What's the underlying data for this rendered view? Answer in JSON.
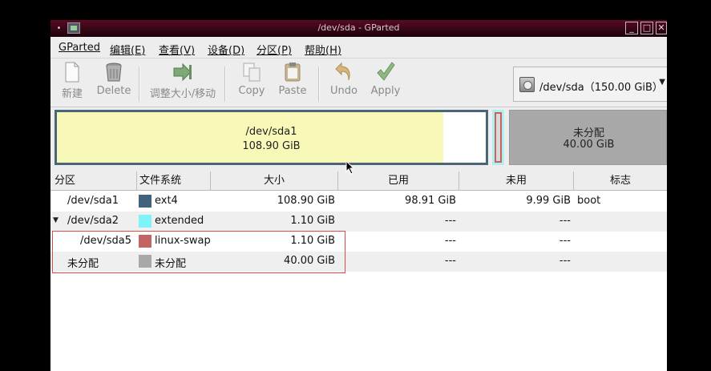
{
  "window": {
    "title": "/dev/sda - GParted",
    "controls": {
      "minimize": "_",
      "maximize": "□",
      "close": "✕"
    }
  },
  "menu": [
    "GParted",
    "编辑(E)",
    "查看(V)",
    "设备(D)",
    "分区(P)",
    "帮助(H)"
  ],
  "toolbar": {
    "new": "新建",
    "delete": "Delete",
    "resize": "调整大小/移动",
    "copy": "Copy",
    "paste": "Paste",
    "undo": "Undo",
    "apply": "Apply"
  },
  "device": {
    "label": "/dev/sda（150.00 GiB）"
  },
  "disk_visual": {
    "sda1": {
      "name": "/dev/sda1",
      "size": "108.90 GiB",
      "used_fraction": 0.9
    },
    "unallocated": {
      "name": "未分配",
      "size": "40.00 GiB"
    }
  },
  "table": {
    "headers": [
      "分区",
      "文件系统",
      "大小",
      "已用",
      "未用",
      "标志"
    ],
    "rows": [
      {
        "partition": "/dev/sda1",
        "fs": "ext4",
        "size": "108.90 GiB",
        "used": "98.91 GiB",
        "unused": "9.99 GiB",
        "flags": "boot",
        "color": "#42617a"
      },
      {
        "partition": "/dev/sda2",
        "fs": "extended",
        "size": "1.10 GiB",
        "used": "---",
        "unused": "---",
        "flags": "",
        "color": "#7ef4f8"
      },
      {
        "partition": "/dev/sda5",
        "fs": "linux-swap",
        "size": "1.10 GiB",
        "used": "---",
        "unused": "---",
        "flags": "",
        "color": "#c36460"
      },
      {
        "partition": "未分配",
        "fs": "未分配",
        "size": "40.00 GiB",
        "used": "---",
        "unused": "---",
        "flags": "",
        "color": "#a8a8a8"
      }
    ]
  }
}
